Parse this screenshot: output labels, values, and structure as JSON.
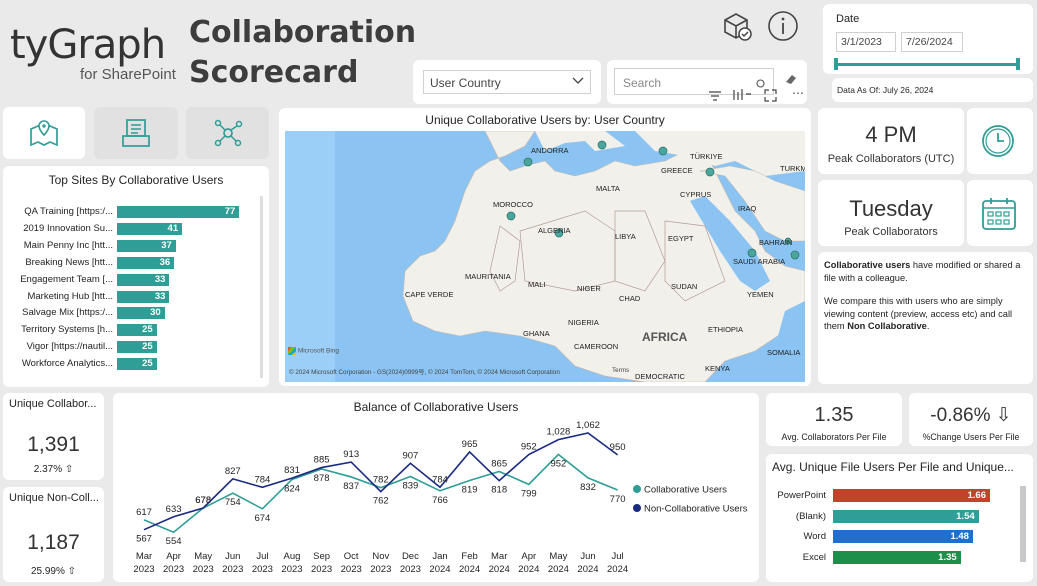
{
  "header": {
    "logo_main": "tyGraph",
    "logo_sub": "for SharePoint",
    "title_line1": "Collaboration",
    "title_line2": "Scorecard"
  },
  "date_slicer": {
    "label": "Date",
    "start": "3/1/2023",
    "end": "7/26/2024",
    "data_as_of": "Data As Of: July 26, 2024"
  },
  "filters": {
    "country_dropdown": "User Country",
    "search_placeholder": "Search"
  },
  "nav_buttons": [
    "map-icon",
    "document-icon",
    "network-icon"
  ],
  "top_sites": {
    "title": "Top Sites By Collaborative Users",
    "items": [
      {
        "label": "QA Training [https:/...",
        "value": "77"
      },
      {
        "label": "2019 Innovation Su...",
        "value": "41"
      },
      {
        "label": "Main Penny Inc [htt...",
        "value": "37"
      },
      {
        "label": "Breaking News [htt...",
        "value": "36"
      },
      {
        "label": "Engagement Team [...",
        "value": "33"
      },
      {
        "label": "Marketing Hub [htt...",
        "value": "33"
      },
      {
        "label": "Salvage Mix [https:/...",
        "value": "30"
      },
      {
        "label": "Territory Systems [h...",
        "value": "25"
      },
      {
        "label": "Vigor [https://nautil...",
        "value": "25"
      },
      {
        "label": "Workforce Analytics...",
        "value": "25"
      }
    ]
  },
  "map": {
    "title": "Unique Collaborative Users by: User Country",
    "labels": [
      "ANDORRA",
      "MALTA",
      "GREECE",
      "TÜRKIYE",
      "TURKM",
      "CYPRUS",
      "MOROCCO",
      "ALGERIA",
      "LIBYA",
      "EGYPT",
      "IRAQ",
      "BAHRAIN",
      "SAUDI ARABIA",
      "MAURITANIA",
      "MALI",
      "NIGER",
      "CHAD",
      "SUDAN",
      "YEMEN",
      "CAPE VERDE",
      "NIGERIA",
      "ETHIOPIA",
      "GHANA",
      "CAMEROON",
      "AFRICA",
      "SOMALIA",
      "KENYA",
      "DEMOCRATIC"
    ],
    "attribution": "© 2024 Microsoft Corporation - GS(2024)0999号, © 2024 TomTom, © 2024 Microsoft Corporation",
    "terms": "Terms",
    "bing": "Microsoft Bing"
  },
  "peak_time": {
    "value": "4 PM",
    "label": "Peak Collaborators (UTC)"
  },
  "peak_day": {
    "value": "Tuesday",
    "label": "Peak Collaborators"
  },
  "info_text": {
    "p1_bold": "Collaborative users",
    "p1_rest": " have modified or shared a file with a colleague.",
    "p2": "We compare this with users who are simply viewing content (preview, access etc) and call them ",
    "p2_bold": "Non Collaborative",
    "p2_end": "."
  },
  "unique_collab": {
    "title": "Unique Collabor...",
    "value": "1,391",
    "change": "2.37% ⇧"
  },
  "unique_noncollab": {
    "title": "Unique Non-Coll...",
    "value": "1,187",
    "change": "25.99% ⇧"
  },
  "avg_collab": {
    "value": "1.35",
    "label": "Avg. Collaborators Per File"
  },
  "pct_change": {
    "value": "-0.86% ⇩",
    "label": "%Change Users Per File"
  },
  "file_users": {
    "title": "Avg. Unique File Users Per File and Unique...",
    "items": [
      {
        "label": "PowerPoint",
        "value": "1.66",
        "color": "#c0432b"
      },
      {
        "label": "(Blank)",
        "value": "1.54",
        "color": "#2e9e96"
      },
      {
        "label": "Word",
        "value": "1.48",
        "color": "#1f6fcf"
      },
      {
        "label": "Excel",
        "value": "1.35",
        "color": "#1e8f4a"
      }
    ]
  },
  "chart_data": {
    "type": "line",
    "title": "Balance of Collaborative Users",
    "x": [
      "Mar 2023",
      "Apr 2023",
      "May 2023",
      "Jun 2023",
      "Jul 2023",
      "Aug 2023",
      "Sep 2023",
      "Oct 2023",
      "Nov 2023",
      "Dec 2023",
      "Jan 2024",
      "Feb 2024",
      "Mar 2024",
      "Apr 2024",
      "May 2024",
      "Jun 2024",
      "Jul 2024"
    ],
    "series": [
      {
        "name": "Collaborative Users",
        "color": "#2e9e96",
        "values": [
          617,
          554,
          678,
          754,
          674,
          824,
          878,
          837,
          782,
          839,
          766,
          819,
          865,
          799,
          952,
          832,
          770
        ]
      },
      {
        "name": "Non-Collaborative Users",
        "color": "#1a2a80",
        "values": [
          567,
          633,
          678,
          827,
          784,
          831,
          885,
          913,
          762,
          907,
          784,
          965,
          818,
          952,
          1028,
          1062,
          950
        ]
      }
    ],
    "ylim": [
      500,
      1100
    ],
    "legend": "right"
  }
}
